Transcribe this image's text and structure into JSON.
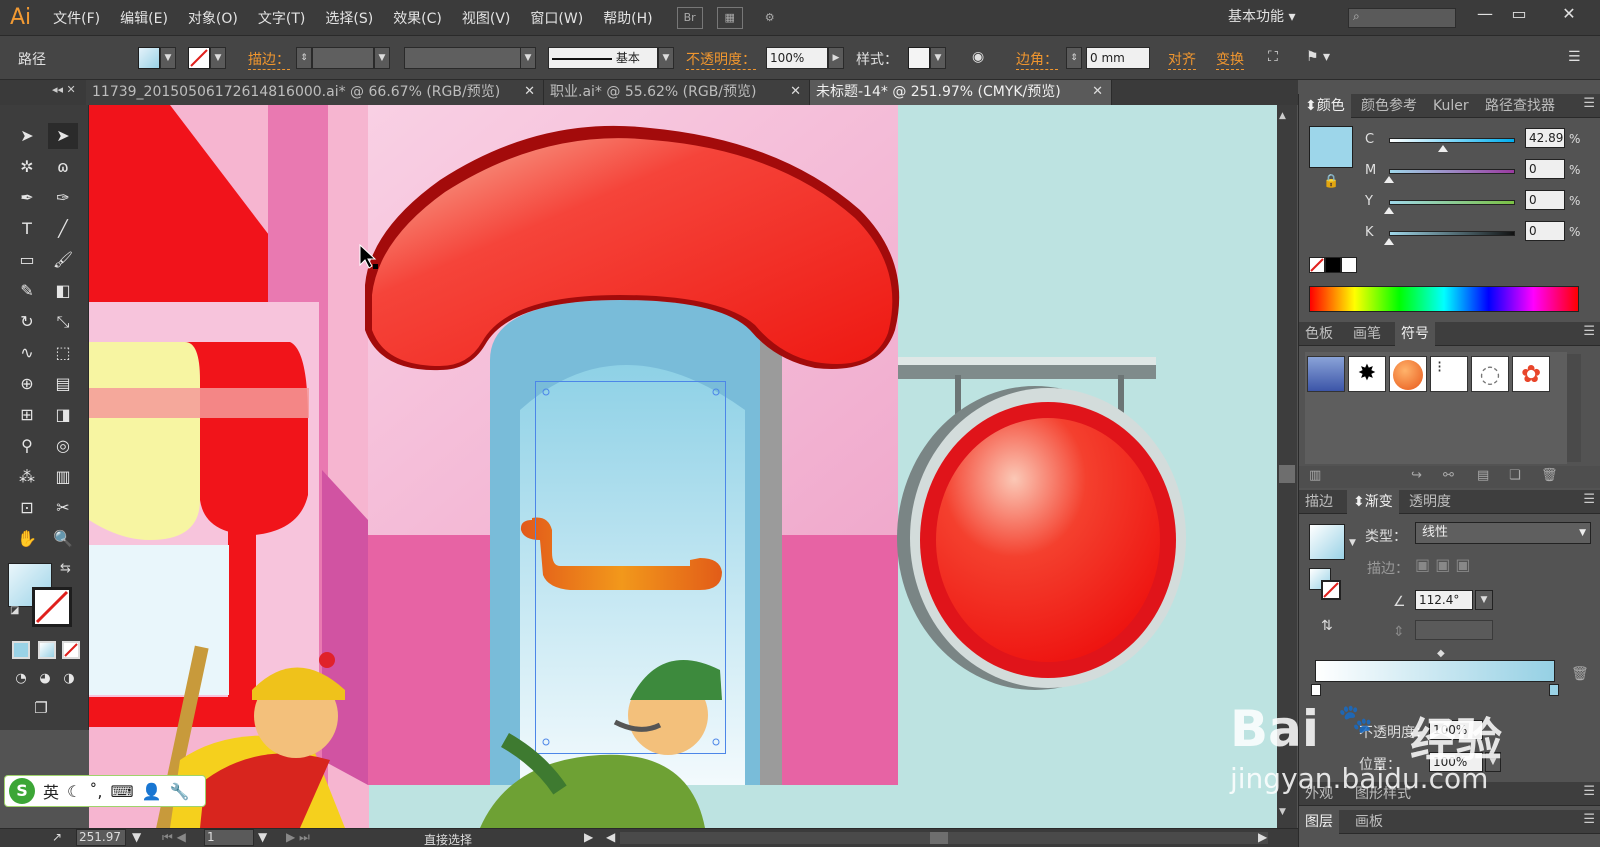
{
  "app": {
    "logo": "Ai",
    "menus": [
      "文件(F)",
      "编辑(E)",
      "对象(O)",
      "文字(T)",
      "选择(S)",
      "效果(C)",
      "视图(V)",
      "窗口(W)",
      "帮助(H)"
    ],
    "bridge_label": "Br",
    "workspace": "基本功能",
    "window_buttons": [
      "—",
      "▭",
      "✕"
    ]
  },
  "control_bar": {
    "selection_label": "路径",
    "stroke_label": "描边：",
    "stroke_style": "基本",
    "opacity_label": "不透明度：",
    "opacity_value": "100%",
    "style_label": "样式：",
    "corner_label": "边角：",
    "corner_value": "0 mm",
    "align_label": "对齐",
    "transform_label": "变换"
  },
  "tabs": [
    {
      "label": "11739_20150506172614816000.ai* @ 66.67% (RGB/预览)",
      "active": false
    },
    {
      "label": "职业.ai* @ 55.62% (RGB/预览)",
      "active": false
    },
    {
      "label": "未标题-14* @ 251.97% (CMYK/预览)",
      "active": true
    }
  ],
  "tab_close": "✕",
  "color_panel": {
    "tabs": [
      "颜色",
      "颜色参考",
      "Kuler",
      "路径查找器"
    ],
    "channels": [
      {
        "label": "C",
        "value": "42.89",
        "fraction": 0.43
      },
      {
        "label": "M",
        "value": "0",
        "fraction": 0
      },
      {
        "label": "Y",
        "value": "0",
        "fraction": 0
      },
      {
        "label": "K",
        "value": "0",
        "fraction": 0
      }
    ],
    "unit": "%"
  },
  "swatch_panel": {
    "tabs": [
      "色板",
      "画笔",
      "符号"
    ]
  },
  "gradient_panel": {
    "tabs": [
      "描边",
      "渐变",
      "透明度"
    ],
    "type_label": "类型：",
    "type_value": "线性",
    "stroke_label": "描边：",
    "angle_value": "112.4°",
    "opacity_label": "不透明度：",
    "opacity_value": "100%",
    "position_label": "位置：",
    "position_value": "100%"
  },
  "bottom_panels": {
    "row1": [
      "外观",
      "图形样式"
    ],
    "row2": [
      "图层",
      "画板"
    ]
  },
  "status": {
    "zoom": "251.97",
    "artboard": "1",
    "tool": "直接选择"
  },
  "ime": {
    "logo": "S",
    "mode": "英"
  },
  "watermark": {
    "brand": "Bai",
    "cn": "经验",
    "url": "jingyan.baidu.com"
  }
}
